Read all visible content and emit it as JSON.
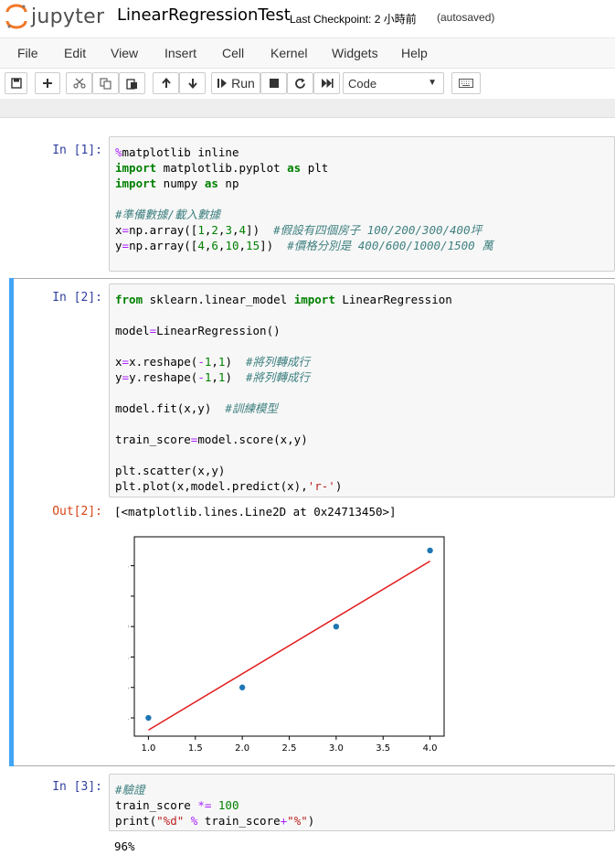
{
  "header": {
    "logo_text": "jupyter",
    "notebook_title": "LinearRegressionTest",
    "checkpoint": "Last Checkpoint: 2 小時前",
    "autosaved": "(autosaved)"
  },
  "menu": [
    "File",
    "Edit",
    "View",
    "Insert",
    "Cell",
    "Kernel",
    "Widgets",
    "Help"
  ],
  "toolbar": {
    "run_label": "Run",
    "cell_type": "Code",
    "icons": [
      "save-icon",
      "plus-icon",
      "cut-icon",
      "copy-icon",
      "paste-icon",
      "arrow-up-icon",
      "arrow-down-icon",
      "run-icon",
      "stop-icon",
      "restart-icon",
      "fast-forward-icon",
      "keyboard-icon"
    ]
  },
  "cells": [
    {
      "prompt": "In [1]:",
      "lines": [
        "%matplotlib inline",
        "import matplotlib.pyplot as plt",
        "import numpy as np",
        "",
        "#準備數據/載入數據",
        "x=np.array([1,2,3,4])  #假設有四個房子 100/200/300/400坪",
        "y=np.array([4,6,10,15])  #價格分別是 400/600/1000/1500 萬"
      ]
    },
    {
      "prompt": "In [2]:",
      "lines": [
        "from sklearn.linear_model import LinearRegression",
        "",
        "model=LinearRegression()",
        "",
        "x=x.reshape(-1,1)  #將列轉成行",
        "y=y.reshape(-1,1)  #將列轉成行",
        "",
        "model.fit(x,y)  #訓練模型",
        "",
        "train_score=model.score(x,y)",
        "",
        "plt.scatter(x,y)",
        "plt.plot(x,model.predict(x),'r-')"
      ],
      "out_prompt": "Out[2]:",
      "output": "[<matplotlib.lines.Line2D at 0x24713450>]"
    },
    {
      "prompt": "In [3]:",
      "lines": [
        "#驗證",
        "train_score *= 100",
        "print(\"%d\" % train_score+\"%\")"
      ],
      "output": "96%"
    }
  ],
  "chart_data": {
    "type": "scatter",
    "x": [
      1,
      2,
      3,
      4
    ],
    "y": [
      4,
      6,
      10,
      15
    ],
    "line": {
      "x": [
        1,
        4
      ],
      "y": [
        3.2,
        14.3
      ],
      "color": "#e31a1c"
    },
    "point_color": "#1f77b4",
    "xlim": [
      0.85,
      4.15
    ],
    "ylim": [
      2.8,
      15.9
    ],
    "xticks": [
      "1.0",
      "1.5",
      "2.0",
      "2.5",
      "3.0",
      "3.5",
      "4.0"
    ],
    "yticks": [
      "4",
      "6",
      "8",
      "10",
      "12",
      "14"
    ],
    "grid": false
  }
}
